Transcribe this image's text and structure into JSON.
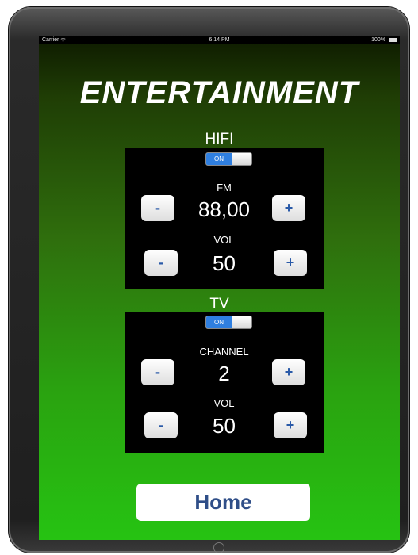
{
  "status_bar": {
    "carrier": "Carrier ᯤ",
    "time": "6:14 PM",
    "battery": "100%"
  },
  "title": "ENTERTAINMENT",
  "hifi": {
    "label": "HIFI",
    "toggle": "ON",
    "band_label": "FM",
    "frequency": "88,00",
    "vol_label": "VOL",
    "volume": "50",
    "minus": "-",
    "plus": "+"
  },
  "tv": {
    "label": "TV",
    "toggle": "ON",
    "channel_label": "CHANNEL",
    "channel": "2",
    "vol_label": "VOL",
    "volume": "50",
    "minus": "-",
    "plus": "+"
  },
  "home_button": "Home"
}
